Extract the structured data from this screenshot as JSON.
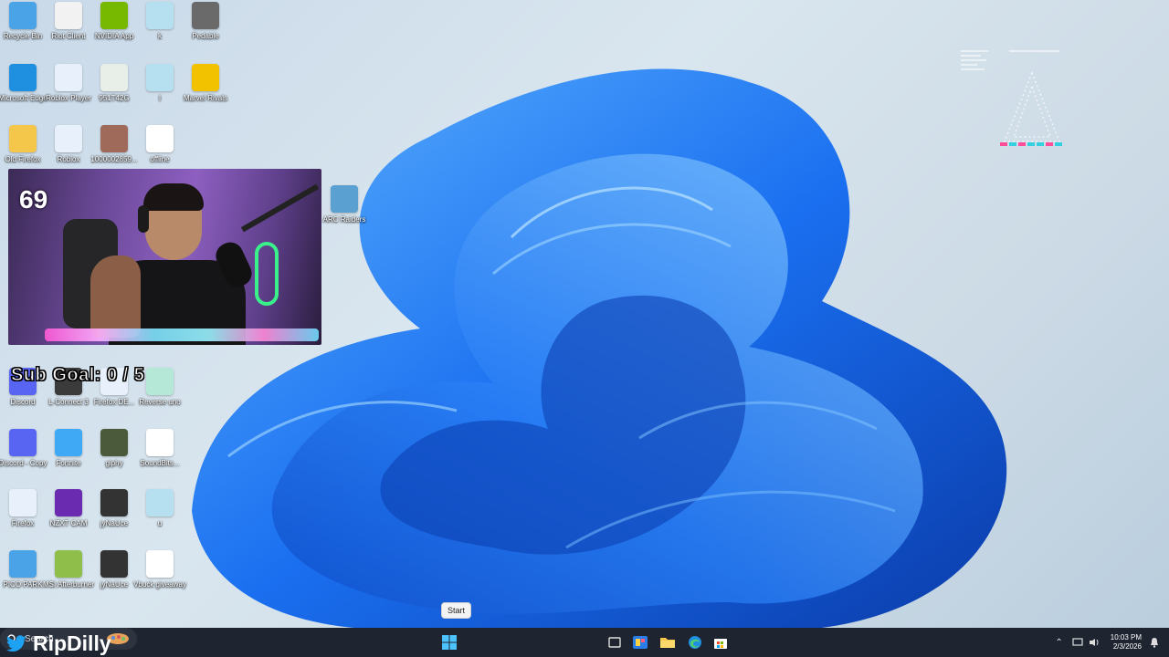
{
  "desktop_icons": [
    {
      "label": "Recycle Bin",
      "color": "#4aa3e6"
    },
    {
      "label": "Riot Client",
      "color": "#f2f2f2"
    },
    {
      "label": "NVIDIA App",
      "color": "#76b900"
    },
    {
      "label": "k",
      "color": "#b6dff0"
    },
    {
      "label": "Pedable",
      "color": "#6a6a6a"
    },
    {
      "label": "Microsoft Edge",
      "color": "#1f8fe0"
    },
    {
      "label": "Roblox Player",
      "color": "#e8f1fb"
    },
    {
      "label": "951T42G",
      "color": "#e8efe8"
    },
    {
      "label": "l",
      "color": "#b6dff0"
    },
    {
      "label": "Marvel Rivals",
      "color": "#f2c200"
    },
    {
      "label": "Old Firefox",
      "color": "#f4c64a"
    },
    {
      "label": "Roblox",
      "color": "#e8f1fb"
    },
    {
      "label": "1000002859...",
      "color": "#a06a5a"
    },
    {
      "label": "offline",
      "color": "#ffffff"
    },
    {
      "label": "ARC Raiders",
      "color": "#5aa0d0"
    },
    {
      "label": "Discord",
      "color": "#5865f2"
    },
    {
      "label": "L-Connect 3",
      "color": "#3b3b3b"
    },
    {
      "label": "Firefox DE...",
      "color": "#e8f1fb"
    },
    {
      "label": "Reverse uno",
      "color": "#b6e8d8"
    },
    {
      "label": "Discord - Copy",
      "color": "#5865f2"
    },
    {
      "label": "Fortnite",
      "color": "#3fa9f5"
    },
    {
      "label": "giphy",
      "color": "#4b5a3a"
    },
    {
      "label": "SoundBits...",
      "color": "#ffffff"
    },
    {
      "label": "Firefox",
      "color": "#e8f1fb"
    },
    {
      "label": "NZXT CAM",
      "color": "#6a2bb0"
    },
    {
      "label": "jyNaUce",
      "color": "#333333"
    },
    {
      "label": "u",
      "color": "#b6dff0"
    },
    {
      "label": "PICO PARK",
      "color": "#4aa3e6"
    },
    {
      "label": "MSI Afterburner",
      "color": "#8fbf4a"
    },
    {
      "label": "jyNaUce",
      "color": "#333333"
    },
    {
      "label": "Vbuck giveaway",
      "color": "#ffffff"
    }
  ],
  "webcam": {
    "counter": "69"
  },
  "sub_goal": {
    "text": "Sub Goal: 0 / 5"
  },
  "tooltip": {
    "start": "Start"
  },
  "taskbar": {
    "watermark": "RipDilly",
    "search_placeholder": "Search",
    "clock_time": "10:03 PM",
    "clock_date": "2/3/2026"
  }
}
